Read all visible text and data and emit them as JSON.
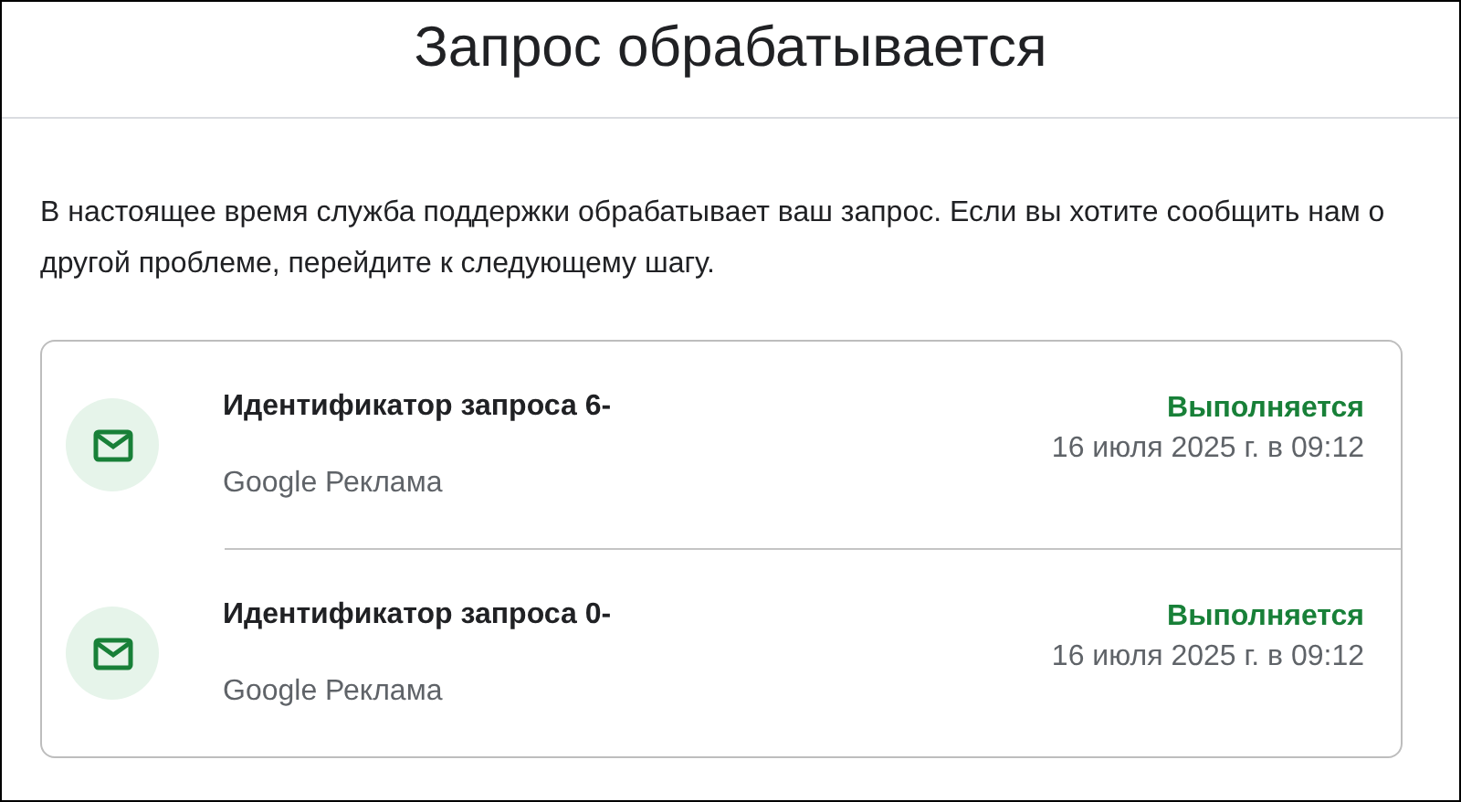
{
  "title": "Запрос обрабатывается",
  "description": "В настоящее время служба поддержки обрабатывает ваш запрос. Если вы хотите сообщить нам о другой проблеме, перейдите к следующему шагу.",
  "requests": [
    {
      "title": "Идентификатор запроса 6-",
      "product": "Google Реклама",
      "status": "Выполняется",
      "date": "16 июля 2025 г. в 09:12"
    },
    {
      "title": "Идентификатор запроса 0-",
      "product": "Google Реклама",
      "status": "Выполняется",
      "date": "16 июля 2025 г. в 09:12"
    }
  ]
}
